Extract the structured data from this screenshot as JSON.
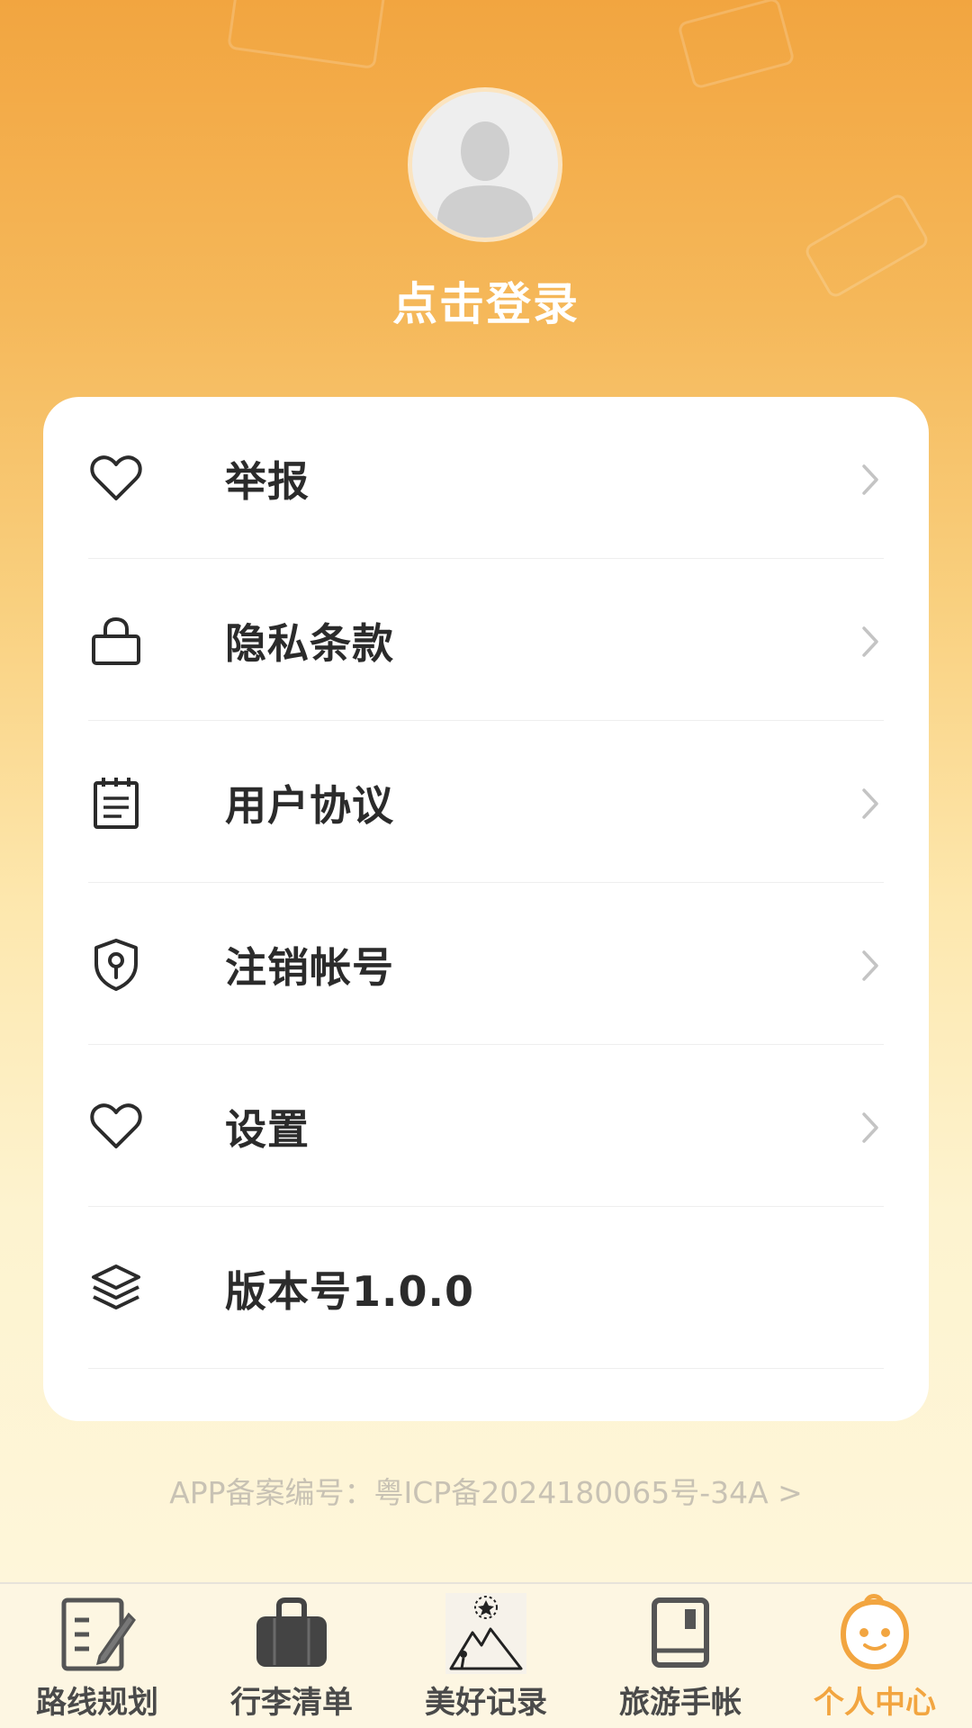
{
  "profile": {
    "login_text": "点击登录"
  },
  "menu": {
    "items": [
      {
        "label": "举报",
        "icon": "heart-icon",
        "has_arrow": true
      },
      {
        "label": "隐私条款",
        "icon": "lock-icon",
        "has_arrow": true
      },
      {
        "label": "用户协议",
        "icon": "notepad-icon",
        "has_arrow": true
      },
      {
        "label": "注销帐号",
        "icon": "shield-icon",
        "has_arrow": true
      },
      {
        "label": "设置",
        "icon": "heart-icon",
        "has_arrow": true
      },
      {
        "label": "版本号1.0.0",
        "icon": "layers-icon",
        "has_arrow": false
      }
    ]
  },
  "footer": {
    "icp_text": "APP备案编号：粤ICP备2024180065号-34A >"
  },
  "tabbar": {
    "tabs": [
      {
        "label": "路线规划",
        "icon": "route-plan-icon",
        "active": false
      },
      {
        "label": "行李清单",
        "icon": "suitcase-icon",
        "active": false
      },
      {
        "label": "美好记录",
        "icon": "mountain-star-icon",
        "active": false
      },
      {
        "label": "旅游手帐",
        "icon": "notebook-icon",
        "active": false
      },
      {
        "label": "个人中心",
        "icon": "smiley-face-icon",
        "active": true
      }
    ]
  },
  "colors": {
    "accent": "#f2a540",
    "header_top": "#f2a540",
    "card_bg": "#ffffff",
    "text_dark": "#2b2b2b",
    "icp_text": "#c8c2b4"
  }
}
